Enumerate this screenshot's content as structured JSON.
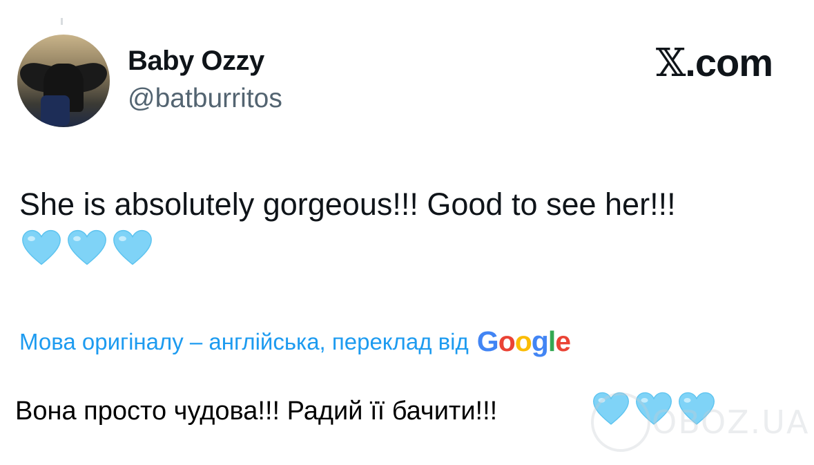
{
  "user": {
    "display_name": "Baby Ozzy",
    "handle": "@batburritos"
  },
  "brand": {
    "x_glyph": "𝕏",
    "domain": ".com"
  },
  "tweet": {
    "text": "She is absolutely gorgeous!!! Good to see her!!!",
    "emoji": [
      "light-blue-heart",
      "light-blue-heart",
      "light-blue-heart"
    ]
  },
  "translation": {
    "note": "Мова оригіналу – англійська, переклад від",
    "google_letters": [
      "G",
      "o",
      "o",
      "g",
      "l",
      "e"
    ],
    "text": "Вона просто чудова!!! Радий її бачити!!!"
  },
  "watermark": {
    "text": "OBOZ.UA"
  },
  "colors": {
    "heart": "#7fd3f7",
    "link": "#1d9bf0",
    "muted": "#536471",
    "google": [
      "#4285F4",
      "#EA4335",
      "#FBBC05",
      "#4285F4",
      "#34A853",
      "#EA4335"
    ]
  }
}
